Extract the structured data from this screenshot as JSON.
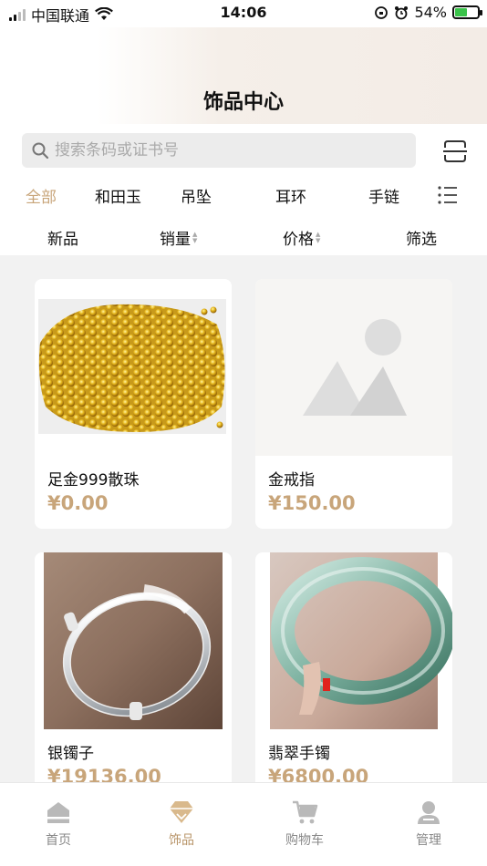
{
  "status_bar": {
    "carrier": "中国联通",
    "time": "14:06",
    "battery": "54%",
    "battery_level": 0.54
  },
  "header": {
    "title": "饰品中心"
  },
  "search": {
    "placeholder": "搜索条码或证书号"
  },
  "categories": [
    {
      "label": "全部",
      "active": true
    },
    {
      "label": "和田玉"
    },
    {
      "label": "吊坠"
    },
    {
      "label": "耳环"
    },
    {
      "label": "手链"
    }
  ],
  "sort": [
    {
      "label": "新品"
    },
    {
      "label": "销量",
      "arrows": true
    },
    {
      "label": "价格",
      "arrows": true
    },
    {
      "label": "筛选"
    }
  ],
  "products": [
    {
      "name": "足金999散珠",
      "price": "¥0.00",
      "image": "gold-beads"
    },
    {
      "name": "金戒指",
      "price": "¥150.00",
      "image": "placeholder-image"
    },
    {
      "name": "银镯子",
      "price": "¥19136.00",
      "image": "silver-bangle"
    },
    {
      "name": "翡翠手镯",
      "price": "¥6800.00",
      "image": "jade-bangle"
    }
  ],
  "tabs": [
    {
      "label": "首页",
      "icon": "home-icon"
    },
    {
      "label": "饰品",
      "icon": "diamond-icon",
      "active": true
    },
    {
      "label": "购物车",
      "icon": "cart-icon"
    },
    {
      "label": "管理",
      "icon": "user-icon"
    }
  ],
  "colors": {
    "accent": "#c8a57a",
    "tab_active": "#b8956a",
    "price": "#c8a57a"
  }
}
